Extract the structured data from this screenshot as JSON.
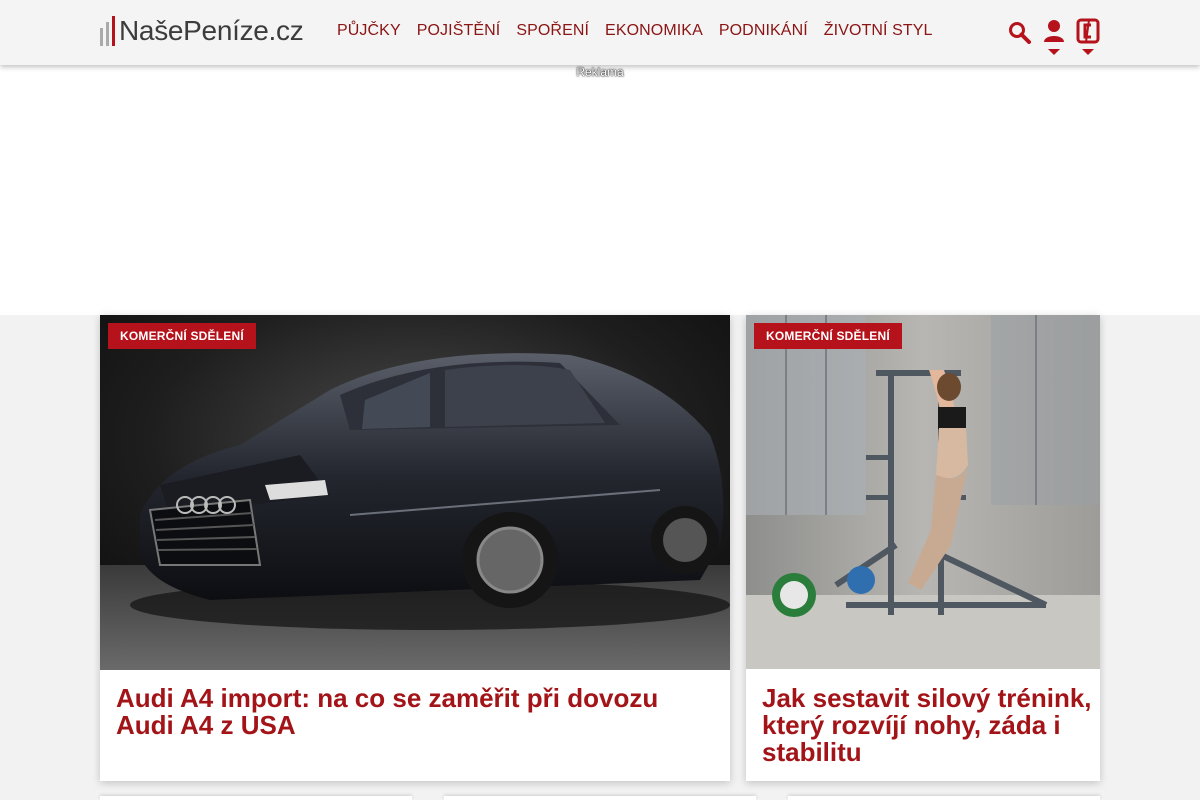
{
  "header": {
    "logo_text": "NašePeníze.cz",
    "nav": [
      "PŮJČKY",
      "POJIŠTĚNÍ",
      "SPOŘENÍ",
      "EKONOMIKA",
      "PODNIKÁNÍ",
      "ŽIVOTNÍ STYL"
    ],
    "icons": [
      "search-icon",
      "user-icon",
      "phone-icon"
    ]
  },
  "ad": {
    "label": "Reklama"
  },
  "articles": [
    {
      "badge": "KOMERČNÍ SDĚLENÍ",
      "title": "Audi A4 import: na co se zaměřit při dovozu Audi A4 z USA",
      "image": "car-photo"
    },
    {
      "badge": "KOMERČNÍ SDĚLENÍ",
      "title": "Jak sestavit silový trénink, který rozvíjí nohy, záda i stabilitu",
      "image": "gym-photo"
    }
  ],
  "colors": {
    "accent": "#b5121b",
    "title": "#a31418",
    "nav": "#8b1414"
  }
}
